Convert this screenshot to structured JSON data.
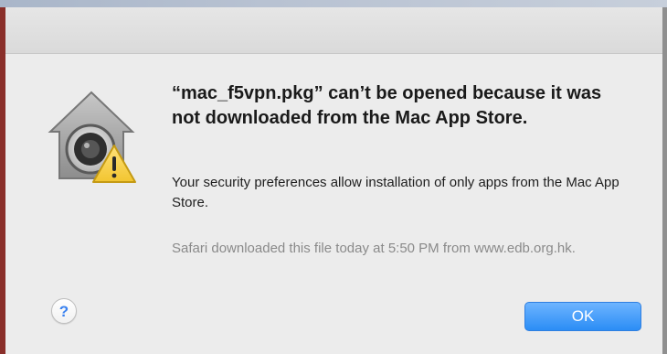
{
  "dialog": {
    "title": "“mac_f5vpn.pkg” can’t be opened because it was not downloaded from the Mac App Store.",
    "message": "Your security preferences allow installation of only apps from the Mac App Store.",
    "source_note": "Safari downloaded this file today at 5:50 PM from www.edb.org.hk.",
    "icon": "gatekeeper-icon",
    "warning_icon": "warning-icon"
  },
  "buttons": {
    "help_label": "?",
    "ok_label": "OK"
  },
  "colors": {
    "dialog_background": "#ececec",
    "ok_button": "#2b8df5",
    "help_glyph": "#3b82f0",
    "warning_yellow": "#f2c530"
  }
}
